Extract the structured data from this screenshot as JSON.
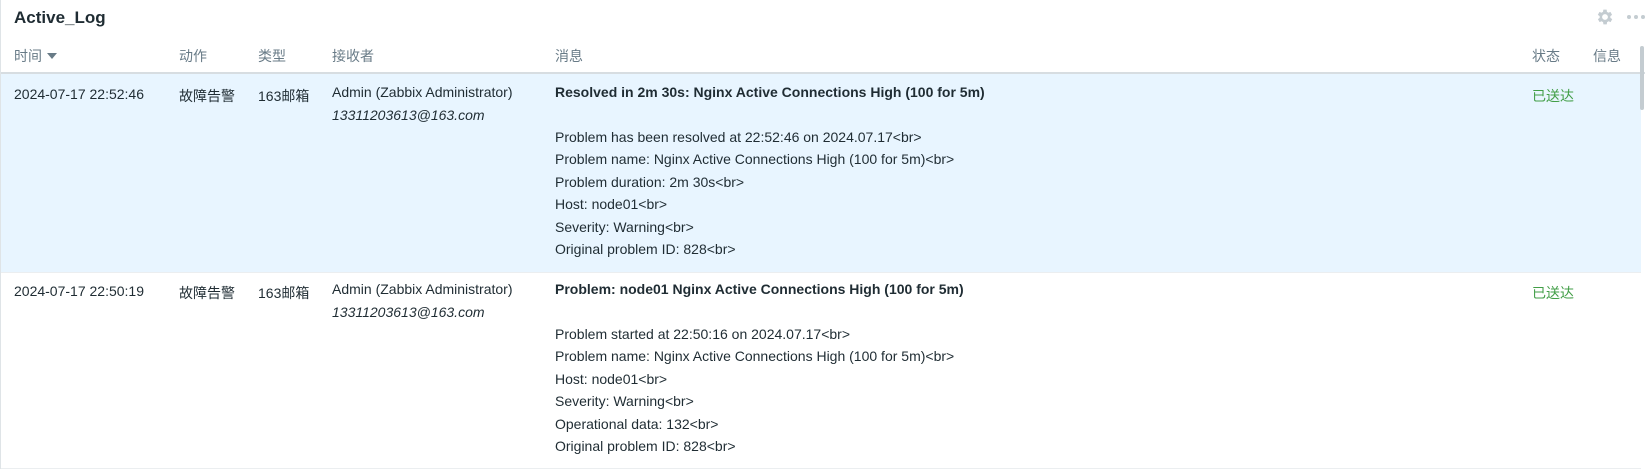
{
  "widget": {
    "title": "Active_Log",
    "settings_icon": "gear-icon",
    "more_icon": "ellipsis-icon"
  },
  "columns": {
    "time": "时间",
    "action": "动作",
    "type": "类型",
    "recipient": "接收者",
    "message": "消息",
    "status": "状态",
    "info": "信息"
  },
  "sort": {
    "column": "time",
    "direction": "desc"
  },
  "rows": [
    {
      "time": "2024-07-17 22:52:46",
      "action": "故障告警",
      "type": "163邮箱",
      "recipient_name": "Admin (Zabbix Administrator)",
      "recipient_email": "13311203613@163.com",
      "subject": "Resolved in 2m 30s: Nginx Active Connections High (100 for 5m)",
      "lines": [
        "Problem has been resolved at 22:52:46 on 2024.07.17<br>",
        "Problem name: Nginx Active Connections High (100 for 5m)<br>",
        "Problem duration: 2m 30s<br>",
        "Host: node01<br>",
        "Severity: Warning<br>",
        "Original problem ID: 828<br>"
      ],
      "status": "已送达",
      "selected": true
    },
    {
      "time": "2024-07-17 22:50:19",
      "action": "故障告警",
      "type": "163邮箱",
      "recipient_name": "Admin (Zabbix Administrator)",
      "recipient_email": "13311203613@163.com",
      "subject": "Problem: node01 Nginx Active Connections High (100 for 5m)",
      "lines": [
        "Problem started at 22:50:16 on 2024.07.17<br>",
        "Problem name: Nginx Active Connections High (100 for 5m)<br>",
        "Host: node01<br>",
        "Severity: Warning<br>",
        "Operational data: 132<br>",
        "Original problem ID: 828<br>"
      ],
      "status": "已送达",
      "selected": false
    }
  ],
  "colors": {
    "selected_row": "#e8f5ff",
    "status_ok": "#429e47",
    "header_text": "#687b87"
  }
}
